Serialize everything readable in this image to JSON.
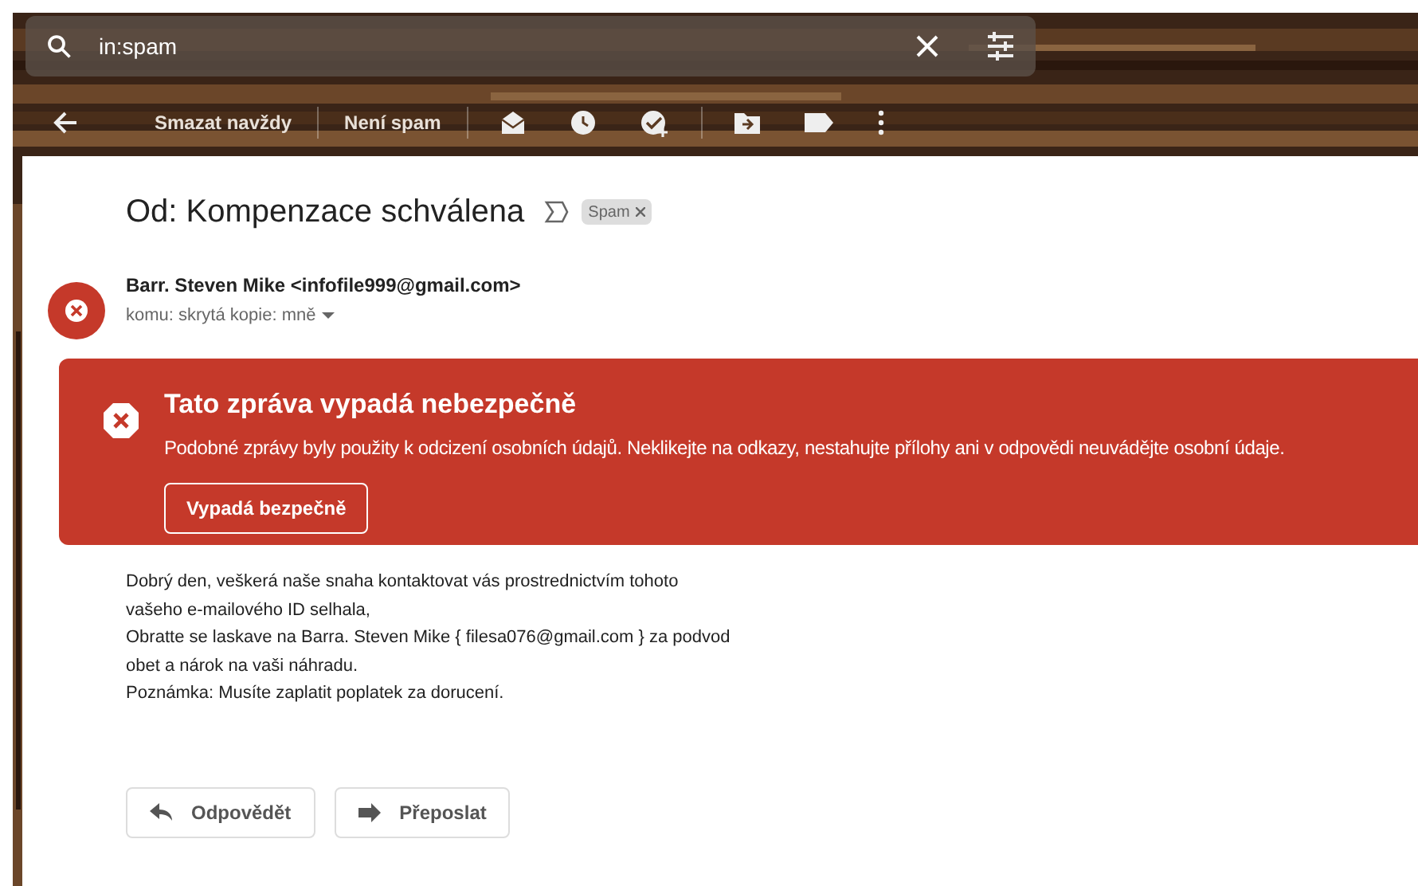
{
  "search": {
    "value": "in:spam"
  },
  "toolbar": {
    "buttons": [
      {
        "label": "Smazat navždy"
      },
      {
        "label": "Není spam"
      }
    ]
  },
  "message": {
    "subject": "Od: Kompenzace schválena",
    "labels": [
      {
        "label": "Spam"
      }
    ],
    "sender": "Barr. Steven Mike <infofile999@gmail.com>",
    "recipient": "komu: skrytá kopie: mně",
    "warning": {
      "title": "Tato zpráva vypadá nebezpečně",
      "text": "Podobné zprávy byly použity k odcizení osobních údajů. Neklikejte na odkazy, nestahujte přílohy ani v odpovědi neuvádějte osobní údaje.",
      "button": "Vypadá bezpečně"
    },
    "body": [
      "Dobrý den, veškerá naše snaha kontaktovat vás prostrednictvím tohoto",
      "vašeho e-mailového ID selhala,",
      "Obratte se laskave na Barra. Steven Mike { filesa076@gmail.com } za podvod",
      "obet a nárok na vaši náhradu.",
      "Poznámka: Musíte zaplatit poplatek za dorucení."
    ],
    "actions": [
      {
        "kind": "reply",
        "label": "Odpovědět"
      },
      {
        "kind": "forward",
        "label": "Přeposlat"
      }
    ]
  }
}
